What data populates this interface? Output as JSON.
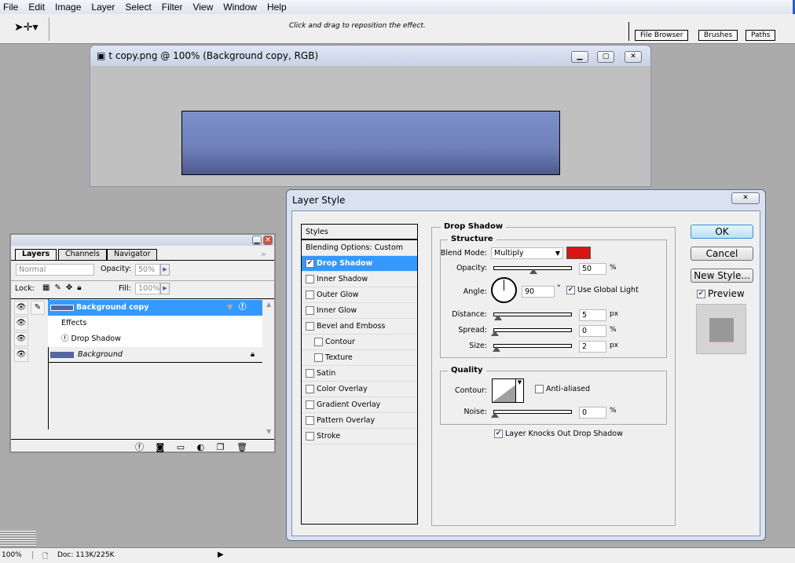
{
  "menu": [
    "File",
    "Edit",
    "Image",
    "Layer",
    "Select",
    "Filter",
    "View",
    "Window",
    "Help"
  ],
  "toolbar": {
    "hint": "Click and drag to reposition the effect.",
    "wells": [
      "File Browser",
      "Brushes",
      "Paths"
    ]
  },
  "document": {
    "title": "t copy.png @ 100% (Background copy, RGB)"
  },
  "dialog": {
    "title": "Layer Style",
    "styles_header": "Styles",
    "styles": [
      {
        "label": "Blending Options: Custom",
        "checkbox": false,
        "selected": false
      },
      {
        "label": "Drop Shadow",
        "checkbox": true,
        "checked": true,
        "selected": true
      },
      {
        "label": "Inner Shadow",
        "checkbox": true,
        "checked": false
      },
      {
        "label": "Outer Glow",
        "checkbox": true,
        "checked": false
      },
      {
        "label": "Inner Glow",
        "checkbox": true,
        "checked": false
      },
      {
        "label": "Bevel and Emboss",
        "checkbox": true,
        "checked": false
      },
      {
        "label": "Contour",
        "checkbox": true,
        "checked": false,
        "indent": true
      },
      {
        "label": "Texture",
        "checkbox": true,
        "checked": false,
        "indent": true
      },
      {
        "label": "Satin",
        "checkbox": true,
        "checked": false
      },
      {
        "label": "Color Overlay",
        "checkbox": true,
        "checked": false
      },
      {
        "label": "Gradient Overlay",
        "checkbox": true,
        "checked": false
      },
      {
        "label": "Pattern Overlay",
        "checkbox": true,
        "checked": false
      },
      {
        "label": "Stroke",
        "checkbox": true,
        "checked": false
      }
    ],
    "section": "Drop Shadow",
    "structure": "Structure",
    "blend_mode_label": "Blend Mode:",
    "blend_mode": "Multiply",
    "shadow_color": "#d81414",
    "opacity_label": "Opacity:",
    "opacity": "50",
    "opacity_unit": "%",
    "angle_label": "Angle:",
    "angle": "90",
    "angle_unit": "°",
    "use_global_light": "Use Global Light",
    "distance_label": "Distance:",
    "distance": "5",
    "distance_unit": "px",
    "spread_label": "Spread:",
    "spread": "0",
    "spread_unit": "%",
    "size_label": "Size:",
    "size": "2",
    "size_unit": "px",
    "quality": "Quality",
    "contour_label": "Contour:",
    "anti_aliased": "Anti-aliased",
    "noise_label": "Noise:",
    "noise": "0",
    "noise_unit": "%",
    "knockout": "Layer Knocks Out Drop Shadow",
    "ok": "OK",
    "cancel": "Cancel",
    "new_style": "New Style...",
    "preview": "Preview"
  },
  "layers_panel": {
    "tabs": [
      "Layers",
      "Channels",
      "Navigator"
    ],
    "blend_mode": "Normal",
    "opacity_label": "Opacity:",
    "opacity": "50%",
    "lock_label": "Lock:",
    "fill_label": "Fill:",
    "fill": "100%",
    "layers": {
      "background_copy": "Background copy",
      "effects": "Effects",
      "drop_shadow": "Drop Shadow",
      "background": "Background"
    }
  },
  "status": {
    "zoom": "100%",
    "doc": "Doc: 113K/225K"
  }
}
